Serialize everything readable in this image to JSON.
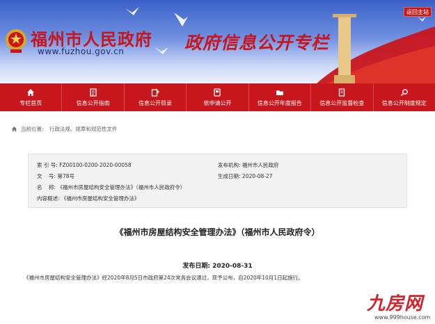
{
  "banner": {
    "site_name": "福州市人民政府",
    "site_url": "www.fuzhou.gov.cn",
    "slogan": "政府信息公开专栏",
    "home_link": "返回主站"
  },
  "nav": {
    "items": [
      {
        "label": "专栏首页",
        "icon": "home-icon"
      },
      {
        "label": "信息公开指南",
        "icon": "guide-icon"
      },
      {
        "label": "信息公开目录",
        "icon": "catalog-icon"
      },
      {
        "label": "依申请公开",
        "icon": "apply-icon"
      },
      {
        "label": "信息公开年度报告",
        "icon": "folder-icon"
      },
      {
        "label": "信息公开监督检查",
        "icon": "inspect-icon"
      },
      {
        "label": "信息公开制度规定",
        "icon": "regulation-icon"
      }
    ]
  },
  "breadcrumb": {
    "prefix": "当前位置:",
    "items": [
      "行政法规、规章和规范性文件"
    ]
  },
  "info": {
    "index_label": "索 引 号:",
    "index_value": "FZ00100-0200-2020-00058",
    "issuer_label": "发布机构:",
    "issuer_value": "福州市人民政府",
    "docno_label": "文    号:",
    "docno_value": "第78号",
    "created_label": "生成日期:",
    "created_value": "2020-08-27",
    "name_label": "名    称:",
    "name_value": "《福州市房屋结构安全管理办法》（福州市人民政府令）",
    "summary_label": "内容概述:",
    "summary_value": "《福州市房屋结构安全管理办法》"
  },
  "content": {
    "title": "《福州市房屋结构安全管理办法》（福州市人民政府令）",
    "pub_date_label": "发布日期:",
    "pub_date_value": "2020-08-31",
    "body": "《福州市房屋结构安全管理办法》经2020年8月5日市政府第24次常务会议通过，现予公布，自2020年10月1日起施行。"
  },
  "watermark": {
    "logo": "九房网",
    "url": "www.999house.com"
  },
  "colors": {
    "brand_red": "#c8161d",
    "banner_blue": "#3a61c9",
    "info_bg": "#f2f2f2"
  }
}
